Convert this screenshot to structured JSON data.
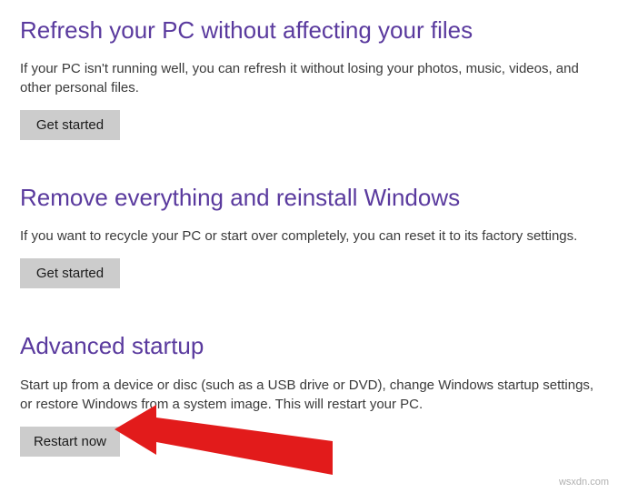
{
  "sections": {
    "refresh": {
      "heading": "Refresh your PC without affecting your files",
      "description": "If your PC isn't running well, you can refresh it without losing your photos, music, videos, and other personal files.",
      "button_label": "Get started"
    },
    "remove": {
      "heading": "Remove everything and reinstall Windows",
      "description": "If you want to recycle your PC or start over completely, you can reset it to its factory settings.",
      "button_label": "Get started"
    },
    "advanced": {
      "heading": "Advanced startup",
      "description": "Start up from a device or disc (such as a USB drive or DVD), change Windows startup settings, or restore Windows from a system image. This will restart your PC.",
      "button_label": "Restart now"
    }
  },
  "watermark": "wsxdn.com",
  "colors": {
    "heading": "#5a3a9e",
    "button_bg": "#cccccc",
    "arrow": "#e21b1b"
  }
}
